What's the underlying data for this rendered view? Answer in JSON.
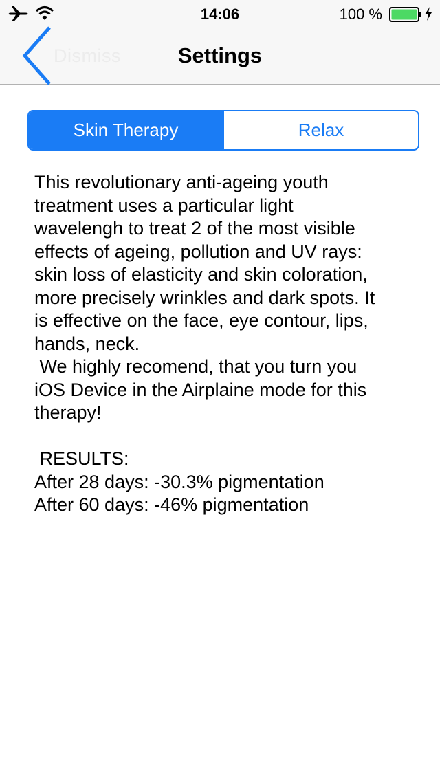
{
  "status_bar": {
    "time": "14:06",
    "battery_percent": "100 %",
    "icons": [
      "airplane-icon",
      "wifi-icon",
      "battery-icon",
      "charging-icon"
    ]
  },
  "navbar": {
    "back_label": "Dismiss",
    "title": "Settings"
  },
  "segmented_control": {
    "options": [
      "Skin Therapy",
      "Relax"
    ],
    "selected": "Skin Therapy"
  },
  "content": {
    "description": "This revolutionary anti-ageing youth\ntreatment uses a particular light\nwavelengh to treat 2 of the most visible\neffects of ageing, pollution and UV rays:\nskin loss of elasticity and skin coloration,\nmore precisely wrinkles and dark spots. It\nis effective on the face, eye contour, lips,\nhands, neck.\n We highly recomend, that you turn you\niOS Device in the Airplaine mode for this\ntherapy!\n\n RESULTS:\nAfter 28 days: -30.3% pigmentation\nAfter 60 days: -46% pigmentation"
  },
  "colors": {
    "accent": "#1a7cf5",
    "battery_green": "#4cd964",
    "bar_background": "#f7f7f7"
  }
}
